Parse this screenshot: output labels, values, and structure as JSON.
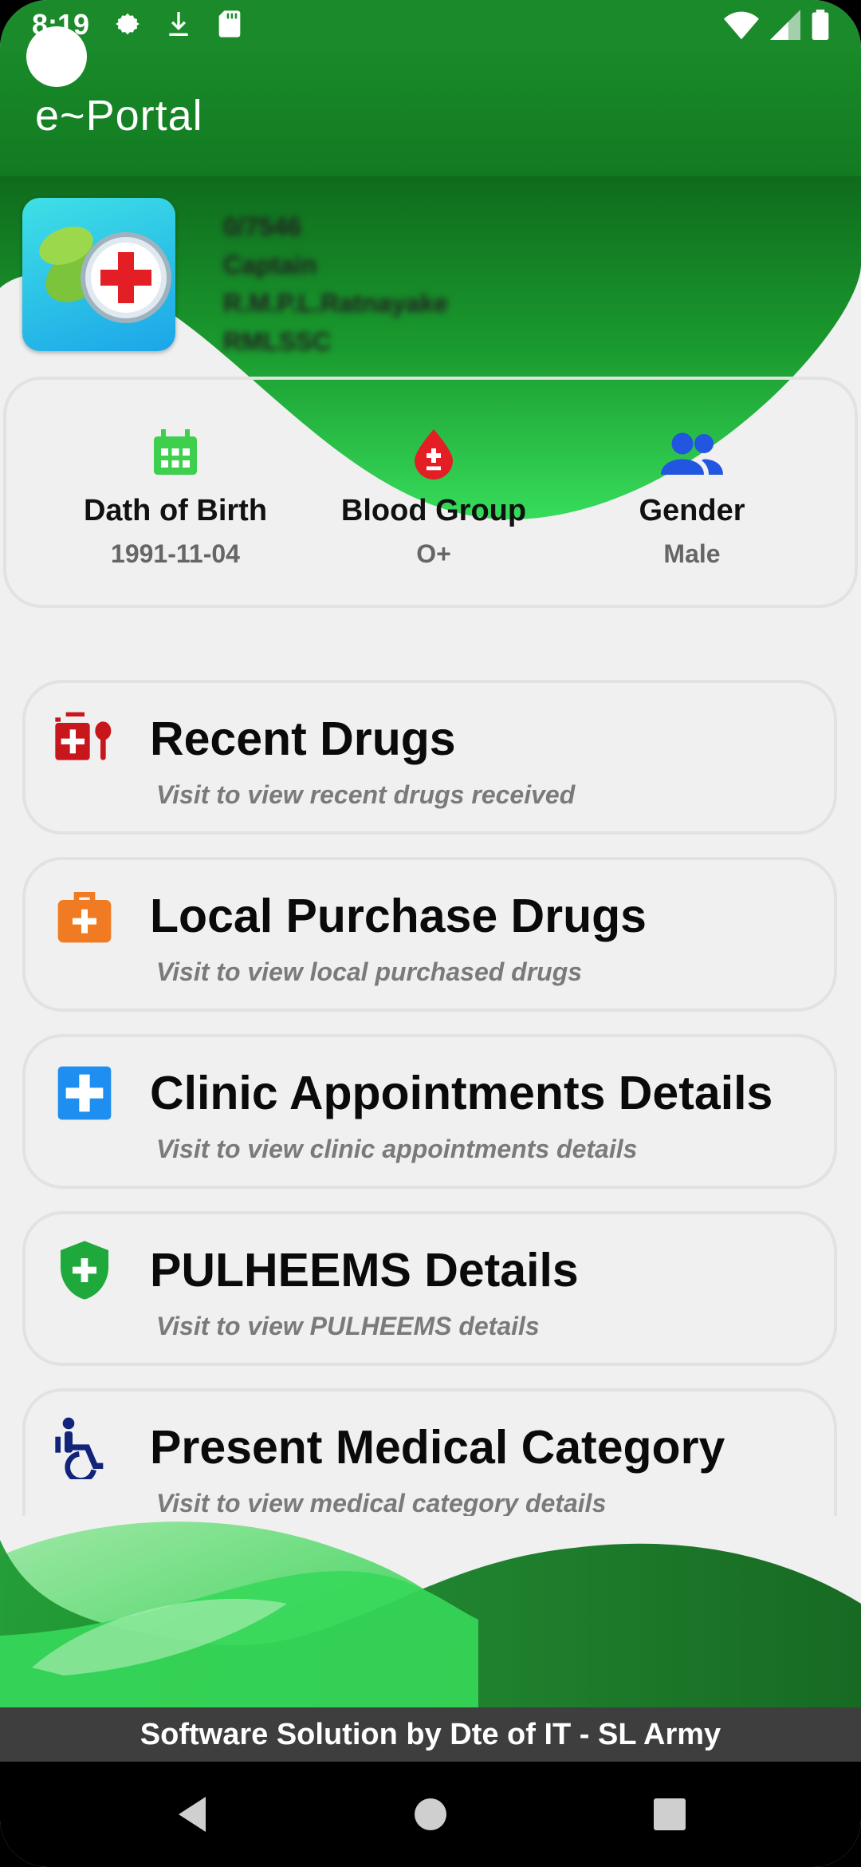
{
  "status_bar": {
    "time": "8:19"
  },
  "app_bar": {
    "title": "e~Portal"
  },
  "profile": {
    "lines": [
      "0/7546",
      "Captain",
      "R.M.P.L.Ratnayake",
      "RMLSSC"
    ]
  },
  "info": {
    "dob": {
      "label": "Dath of Birth",
      "value": "1991-11-04"
    },
    "blood": {
      "label": "Blood Group",
      "value": "O+"
    },
    "gender": {
      "label": "Gender",
      "value": "Male"
    }
  },
  "menu": [
    {
      "title": "Recent Drugs",
      "subtitle": "Visit to view recent drugs received"
    },
    {
      "title": "Local Purchase Drugs",
      "subtitle": "Visit to view local purchased drugs"
    },
    {
      "title": "Clinic Appointments Details",
      "subtitle": "Visit to view clinic appointments details"
    },
    {
      "title": "PULHEEMS Details",
      "subtitle": "Visit to view PULHEEMS details"
    },
    {
      "title": "Present Medical Category",
      "subtitle": "Visit to view medical category details"
    }
  ],
  "footer": {
    "text": "Software Solution by Dte of IT - SL Army"
  },
  "colors": {
    "primary_green": "#1a8a2b",
    "wave_light": "#36d85a",
    "footer_bg": "#3e3e3e"
  }
}
